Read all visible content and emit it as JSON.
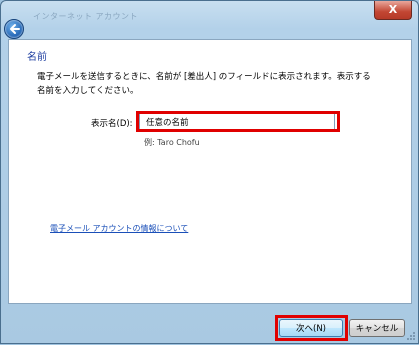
{
  "window": {
    "title": "インターネット アカウント",
    "close_label": "X"
  },
  "content": {
    "heading": "名前",
    "intro": "電子メールを送信するときに、名前が [差出人] のフィールドに表示されます。表示する名前を入力してください。",
    "display_name": {
      "label": "表示名(D):",
      "value": "任意の名前"
    },
    "example": "例: Taro Chofu",
    "help_link": "電子メール アカウントの情報について"
  },
  "footer": {
    "next_label": "次へ(N)",
    "cancel_label": "キャンセル"
  },
  "colors": {
    "highlight": "#e00000",
    "heading": "#1f3fa0",
    "link": "#1a4fb8"
  }
}
